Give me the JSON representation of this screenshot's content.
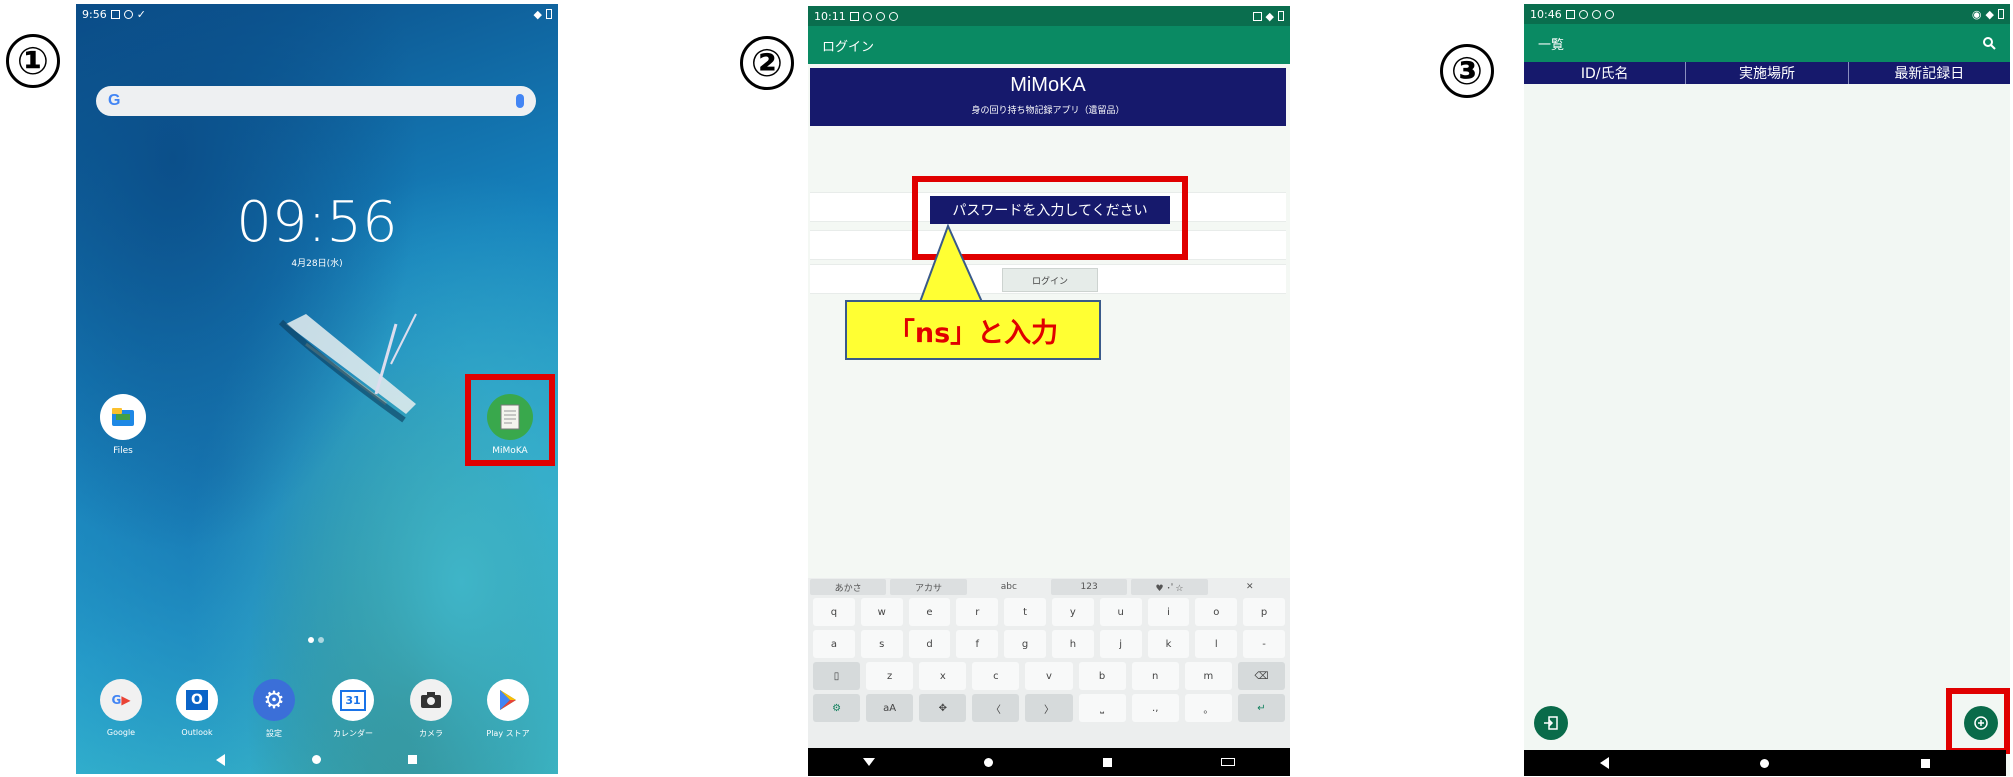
{
  "steps": {
    "s1": "①",
    "s2": "②",
    "s3": "③"
  },
  "phone1": {
    "time": "9:56",
    "clock": "09:56",
    "date": "4月28日(水)",
    "search_logo": "G",
    "apps": [
      {
        "label": "Files"
      },
      {
        "label": "MiMoKA"
      }
    ],
    "dock": [
      "Google",
      "Outlook",
      "設定",
      "カレンダー",
      "カメラ",
      "Play ストア"
    ],
    "calendar_day": "31"
  },
  "phone2": {
    "time": "10:11",
    "appbar_title": "ログイン",
    "banner_title": "MiMoKA",
    "banner_subtitle": "身の回り持ち物記録アプリ（遺留品）",
    "password_prompt": "パスワードを入力してください",
    "login_button": "ログイン",
    "callout": "「ns」と入力",
    "keyboard": {
      "tabs": [
        "あかさ",
        "アカサ",
        "abc",
        "123",
        "♥ ･ﾟ☆",
        "✕"
      ],
      "row1": [
        "q",
        "w",
        "e",
        "r",
        "t",
        "y",
        "u",
        "i",
        "o",
        "p"
      ],
      "row2": [
        "a",
        "s",
        "d",
        "f",
        "g",
        "h",
        "j",
        "k",
        "l",
        "-"
      ],
      "row3": [
        "▯",
        "z",
        "x",
        "c",
        "v",
        "b",
        "n",
        "m",
        "⌫"
      ],
      "row4": [
        "⚙",
        "aA",
        "✥",
        "〈",
        "〉",
        "⎵",
        ".,",
        "。",
        "↵"
      ]
    }
  },
  "phone3": {
    "time": "10:46",
    "appbar_title": "一覧",
    "columns": [
      "ID/氏名",
      "実施場所",
      "最新記録日"
    ]
  },
  "colors": {
    "highlight_red": "#e00000",
    "navy": "#16196c",
    "teal": "#0a8a63",
    "callout_yellow": "#ffff33"
  }
}
